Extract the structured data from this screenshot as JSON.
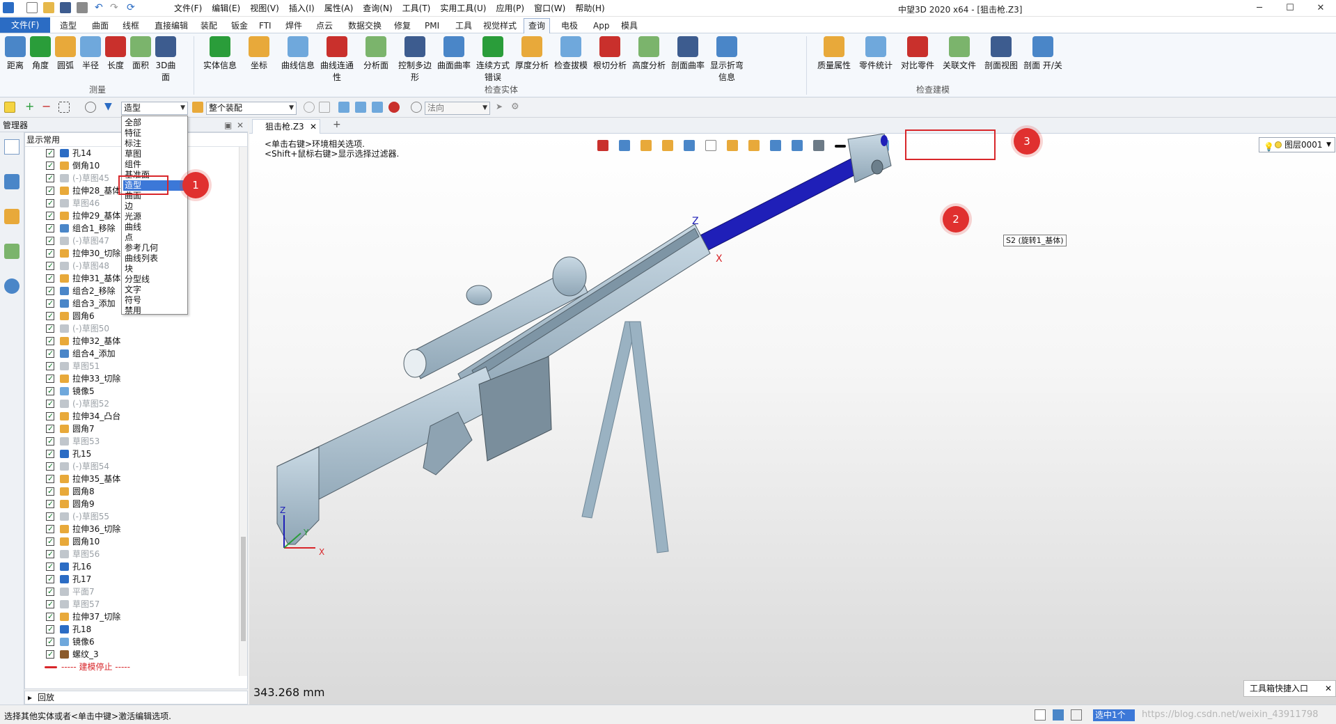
{
  "title_bar": {
    "window_title": "中望3D 2020 x64 - [狙击枪.Z3]",
    "menus": [
      "文件(F)",
      "编辑(E)",
      "视图(V)",
      "插入(I)",
      "属性(A)",
      "查询(N)",
      "工具(T)",
      "实用工具(U)",
      "应用(P)",
      "窗口(W)",
      "帮助(H)"
    ]
  },
  "ribbon_tabs": [
    "文件(F)",
    "造型",
    "曲面",
    "线框",
    "直接编辑",
    "装配",
    "钣金",
    "FTI",
    "焊件",
    "点云",
    "数据交换",
    "修复",
    "PMI",
    "工具",
    "视觉样式",
    "查询",
    "电极",
    "App",
    "模具"
  ],
  "active_tab": "查询",
  "ribbon": {
    "groups": [
      {
        "label": "测量",
        "buttons": [
          "距离",
          "角度",
          "圆弧",
          "半径",
          "长度",
          "面积",
          "3D曲面"
        ]
      },
      {
        "label": "检查实体",
        "buttons": [
          "实体信息",
          "坐标",
          "曲线信息",
          "曲线连通性",
          "分析面",
          "控制多边形",
          "曲面曲率",
          "连续方式错误",
          "厚度分析",
          "检查拔模",
          "根切分析",
          "高度分析",
          "剖面曲率",
          "显示折弯信息"
        ]
      },
      {
        "label": "检查建模",
        "buttons": [
          "质量属性",
          "零件统计",
          "对比零件",
          "关联文件",
          "剖面视图",
          "剖面 开/关"
        ]
      }
    ]
  },
  "toolbar2": {
    "filter_value": "造型",
    "assembly_value": "整个装配",
    "direction_value": "法向"
  },
  "manager": {
    "title": "管理器",
    "filter_label": "显示常用",
    "playback_label": "回放"
  },
  "filter_dropdown": {
    "options": [
      "全部",
      "特征",
      "标注",
      "草图",
      "组件",
      "基准面",
      "造型",
      "曲面",
      "边",
      "光源",
      "曲线",
      "点",
      "参考几何",
      "曲线列表",
      "块",
      "分型线",
      "文字",
      "符号",
      "禁用"
    ],
    "selected": "造型"
  },
  "tree": [
    {
      "label": "孔14",
      "icon": "hole",
      "dim": false
    },
    {
      "label": "倒角10",
      "icon": "chamfer",
      "dim": false
    },
    {
      "label": "(-)草图45",
      "icon": "sketch",
      "dim": true
    },
    {
      "label": "拉伸28_基体",
      "icon": "extrude",
      "dim": false
    },
    {
      "label": "草图46",
      "icon": "sketch",
      "dim": true
    },
    {
      "label": "拉伸29_基体",
      "icon": "extrude",
      "dim": false
    },
    {
      "label": "组合1_移除",
      "icon": "combine",
      "dim": false
    },
    {
      "label": "(-)草图47",
      "icon": "sketch",
      "dim": true
    },
    {
      "label": "拉伸30_切除",
      "icon": "extrude",
      "dim": false
    },
    {
      "label": "(-)草图48",
      "icon": "sketch",
      "dim": true
    },
    {
      "label": "拉伸31_基体",
      "icon": "extrude",
      "dim": false
    },
    {
      "label": "组合2_移除",
      "icon": "combine",
      "dim": false
    },
    {
      "label": "组合3_添加",
      "icon": "combine",
      "dim": false
    },
    {
      "label": "圆角6",
      "icon": "fillet",
      "dim": false
    },
    {
      "label": "(-)草图50",
      "icon": "sketch",
      "dim": true
    },
    {
      "label": "拉伸32_基体",
      "icon": "extrude",
      "dim": false
    },
    {
      "label": "组合4_添加",
      "icon": "combine",
      "dim": false
    },
    {
      "label": "草图51",
      "icon": "sketch",
      "dim": true
    },
    {
      "label": "拉伸33_切除",
      "icon": "extrude",
      "dim": false
    },
    {
      "label": "镜像5",
      "icon": "mirror",
      "dim": false
    },
    {
      "label": "(-)草图52",
      "icon": "sketch",
      "dim": true
    },
    {
      "label": "拉伸34_凸台",
      "icon": "extrude",
      "dim": false
    },
    {
      "label": "圆角7",
      "icon": "fillet",
      "dim": false
    },
    {
      "label": "草图53",
      "icon": "sketch",
      "dim": true
    },
    {
      "label": "孔15",
      "icon": "hole",
      "dim": false
    },
    {
      "label": "(-)草图54",
      "icon": "sketch",
      "dim": true
    },
    {
      "label": "拉伸35_基体",
      "icon": "extrude",
      "dim": false
    },
    {
      "label": "圆角8",
      "icon": "fillet",
      "dim": false
    },
    {
      "label": "圆角9",
      "icon": "fillet",
      "dim": false
    },
    {
      "label": "(-)草图55",
      "icon": "sketch",
      "dim": true
    },
    {
      "label": "拉伸36_切除",
      "icon": "extrude",
      "dim": false
    },
    {
      "label": "圆角10",
      "icon": "fillet",
      "dim": false
    },
    {
      "label": "草图56",
      "icon": "sketch",
      "dim": true
    },
    {
      "label": "孔16",
      "icon": "hole",
      "dim": false
    },
    {
      "label": "孔17",
      "icon": "hole",
      "dim": false
    },
    {
      "label": "平面7",
      "icon": "plane",
      "dim": true
    },
    {
      "label": "草图57",
      "icon": "sketch",
      "dim": true
    },
    {
      "label": "拉伸37_切除",
      "icon": "extrude",
      "dim": false
    },
    {
      "label": "孔18",
      "icon": "hole",
      "dim": false
    },
    {
      "label": "镜像6",
      "icon": "mirror",
      "dim": false
    },
    {
      "label": "螺纹_3",
      "icon": "thread",
      "dim": false
    },
    {
      "label": "----- 建模停止 -----",
      "icon": "stop",
      "dim": false
    }
  ],
  "document": {
    "tab_label": "狙击枪.Z3",
    "hint_line1": "<单击右键>环境相关选项.",
    "hint_line2": "<Shift+鼠标右键>显示选择过滤器.",
    "layer_value": "图层0001",
    "measure_readout": "343.268 mm",
    "tooltip_label": "S2 (旋转1_基体)",
    "shortcut_label": "工具箱快捷入口"
  },
  "axes": {
    "z": "Z",
    "y": "Y",
    "x": "X"
  },
  "annotations": [
    "1",
    "2",
    "3"
  ],
  "status_bar": {
    "message": "选择其他实体或者<单击中键>激活编辑选项.",
    "selection": "选中1个",
    "watermark": "https://blog.csdn.net/weixin_43911798"
  },
  "colors": {
    "accent": "#2b6cc4",
    "model": "#a8bfcf",
    "barrel": "#1f1fb8",
    "marker": "#e0302f"
  }
}
